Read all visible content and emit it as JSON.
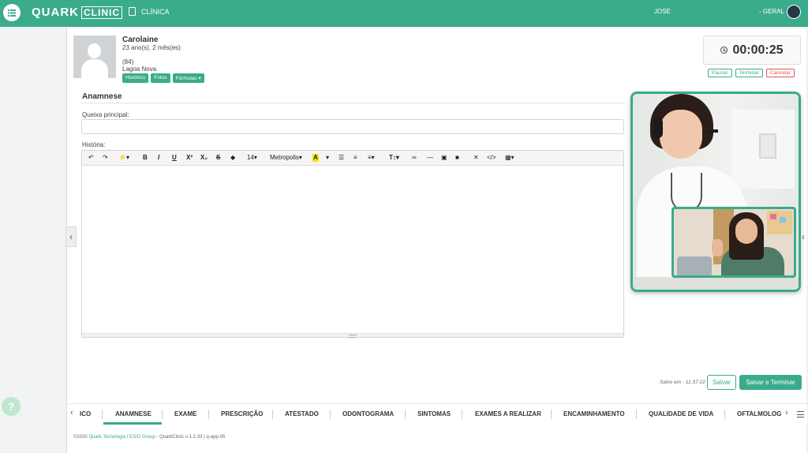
{
  "header": {
    "logo_main": "QUARK",
    "logo_box": "CLINIC",
    "nav_label": "CLÍNICA",
    "user": "JOSE",
    "unit": "- GERAL"
  },
  "patient": {
    "name": "Carolaine",
    "age": "23 ano(s), 2 mês(es)",
    "phone": "(84)",
    "city": "Lagoa Nova",
    "buttons": [
      "Histórico",
      "Fotos",
      "Fórmulas ▾"
    ]
  },
  "timer": {
    "value": "00:00:25",
    "pause": "Pausar",
    "finish": "Terminar",
    "cancel": "Cancelar"
  },
  "form": {
    "section": "Anamnese",
    "complaint_label": "Queixa principal:",
    "complaint_value": "",
    "history_label": "História:",
    "toolbar": {
      "font_size": "14",
      "font_family": "Metropolis"
    }
  },
  "save": {
    "saved_text": "Salvo em - 11:37:22",
    "save": "Salvar",
    "save_finish": "Salvar e Terminar"
  },
  "tabs": [
    "ICO",
    "ANAMNESE",
    "EXAME",
    "PRESCRIÇÃO",
    "ATESTADO",
    "ODONTOGRAMA",
    "SINTOMAS",
    "EXAMES A REALIZAR",
    "ENCAMINHAMENTO",
    "QUALIDADE DE VIDA",
    "OFTALMOLOG"
  ],
  "active_tab": "ANAMNESE",
  "footer": {
    "prefix": "©2020 ",
    "company": "Quark Tecnologia",
    "sep": " / ",
    "group": "ESIG Group",
    "suffix": " - QuarkClinic v-1.2.33 | q-app-05"
  },
  "colors": {
    "accent": "#3aab8b",
    "danger": "#e25555"
  }
}
